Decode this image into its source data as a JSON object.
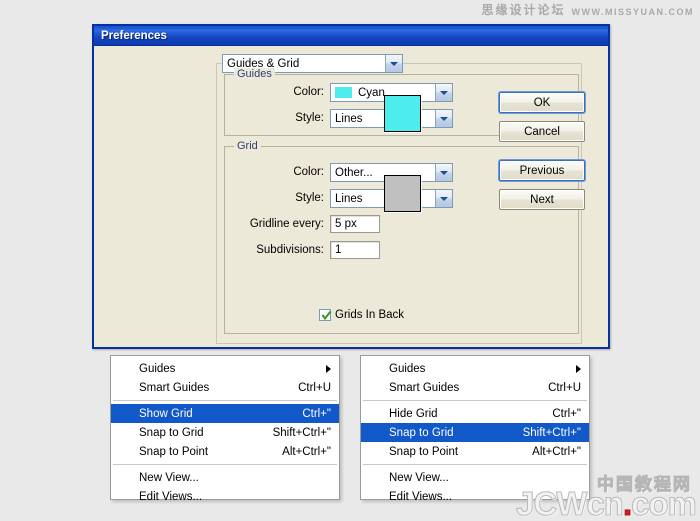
{
  "watermarks": {
    "top_cn": "思缘设计论坛",
    "top_en": "WWW.MISSYUAN.COM",
    "bottom_cn": "中国教程网",
    "bottom_en_a": "JCWcn",
    "bottom_dot": ".",
    "bottom_en_b": "com"
  },
  "dialog": {
    "title": "Preferences",
    "section_select": {
      "value": "Guides & Grid",
      "icon": "chevron-down-icon"
    },
    "guides": {
      "legend": "Guides",
      "color_label": "Color:",
      "color_value": "Cyan",
      "color_hex": "#4DEDEE",
      "style_label": "Style:",
      "style_value": "Lines",
      "swatch_hex": "#4DEDEE"
    },
    "grid": {
      "legend": "Grid",
      "color_label": "Color:",
      "color_value": "Other...",
      "style_label": "Style:",
      "style_value": "Lines",
      "gridline_label": "Gridline every:",
      "gridline_value": "5 px",
      "subdivisions_label": "Subdivisions:",
      "subdivisions_value": "1",
      "grids_in_back_label": "Grids In Back",
      "grids_in_back_checked": true,
      "swatch_hex": "#C0C0C0"
    },
    "buttons": {
      "ok": "OK",
      "cancel": "Cancel",
      "previous": "Previous",
      "next": "Next"
    }
  },
  "menu_left": {
    "items": [
      {
        "label": "Guides",
        "accel": "",
        "submenu": true,
        "selected": false
      },
      {
        "label": "Smart Guides",
        "accel": "Ctrl+U",
        "submenu": false,
        "selected": false
      },
      {
        "separator": true
      },
      {
        "label": "Show Grid",
        "accel": "Ctrl+\"",
        "submenu": false,
        "selected": true
      },
      {
        "label": "Snap to Grid",
        "accel": "Shift+Ctrl+\"",
        "submenu": false,
        "selected": false
      },
      {
        "label": "Snap to Point",
        "accel": "Alt+Ctrl+\"",
        "submenu": false,
        "selected": false
      },
      {
        "separator": true
      },
      {
        "label": "New View...",
        "accel": "",
        "submenu": false,
        "selected": false
      },
      {
        "label": "Edit Views...",
        "accel": "",
        "submenu": false,
        "selected": false
      }
    ]
  },
  "menu_right": {
    "items": [
      {
        "label": "Guides",
        "accel": "",
        "submenu": true,
        "selected": false
      },
      {
        "label": "Smart Guides",
        "accel": "Ctrl+U",
        "submenu": false,
        "selected": false
      },
      {
        "separator": true
      },
      {
        "label": "Hide Grid",
        "accel": "Ctrl+\"",
        "submenu": false,
        "selected": false
      },
      {
        "label": "Snap to Grid",
        "accel": "Shift+Ctrl+\"",
        "submenu": false,
        "selected": true
      },
      {
        "label": "Snap to Point",
        "accel": "Alt+Ctrl+\"",
        "submenu": false,
        "selected": false
      },
      {
        "separator": true
      },
      {
        "label": "New View...",
        "accel": "",
        "submenu": false,
        "selected": false
      },
      {
        "label": "Edit Views...",
        "accel": "",
        "submenu": false,
        "selected": false
      }
    ]
  }
}
